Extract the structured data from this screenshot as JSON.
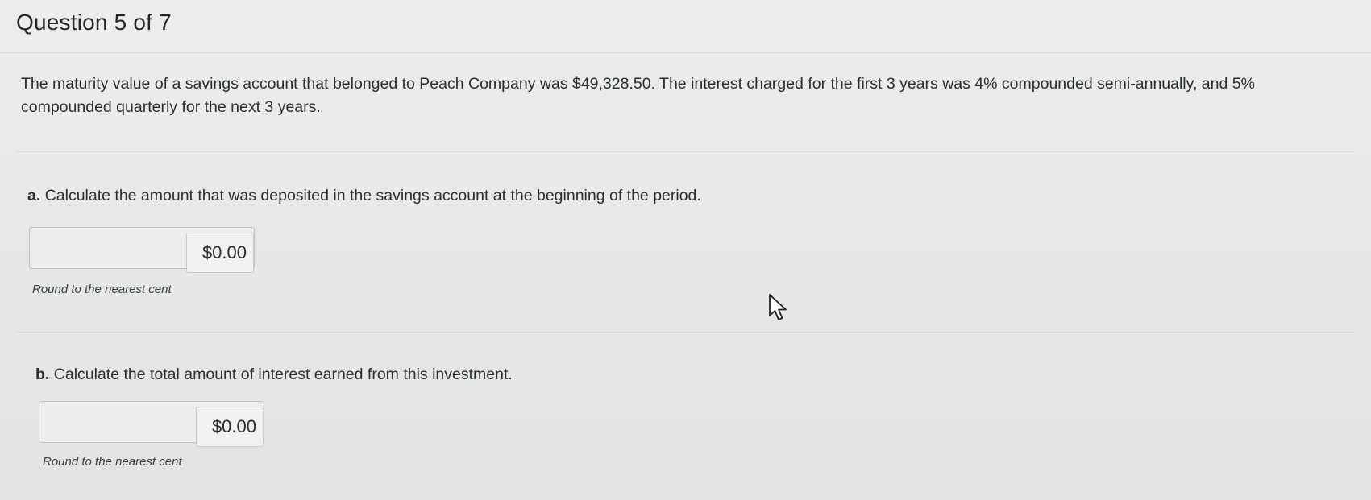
{
  "header": {
    "title": "Question 5 of 7"
  },
  "question": {
    "prompt": "The maturity value of a savings account that belonged to Peach Company was $49,328.50. The interest charged for the first 3 years was 4% compounded semi-annually, and 5% compounded quarterly for the next 3 years."
  },
  "parts": [
    {
      "letter": "a.",
      "text": "Calculate the amount that was deposited in the savings account at the beginning of the period.",
      "value": "$0.00",
      "hint": "Round to the nearest cent"
    },
    {
      "letter": "b.",
      "text": "Calculate the total amount of interest earned from this investment.",
      "value": "$0.00",
      "hint": "Round to the nearest cent"
    }
  ],
  "icons": {
    "cursor": "mouse-pointer-icon"
  }
}
